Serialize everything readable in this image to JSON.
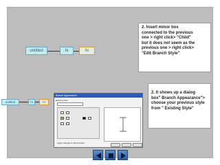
{
  "diagram_top": {
    "root_label": "untitled",
    "child_label": "hi",
    "new_child_label": "hi"
  },
  "note_top": {
    "lines": [
      "2. Insert minor box",
      "connected to the previous",
      "one > right click> \"Child\"",
      "but it does not seem as the",
      "previous one > right click>",
      " \"Edit Branch Style\""
    ]
  },
  "diagram_bottom": {
    "root_label": "untitled",
    "child_label": "hi",
    "new_child_label": "hi"
  },
  "dialog": {
    "title": "Branch Appearance",
    "tabs": "Existing Style",
    "check_label": "Apply changes to all branches"
  },
  "note_bottom": {
    "lines": [
      "2. It shows up a dialog",
      "box\" Branch Appearance\">",
      "choose your previous style",
      "from \" Existing Style\""
    ]
  },
  "navigation": {
    "previous_icon": "arrow-left-icon",
    "home_icon": "square-stop-icon",
    "next_icon": "arrow-right-icon"
  },
  "colors": {
    "frame_bg": "#bdbdbd",
    "node_fill": "#c4ecec",
    "node_border": "#6aa6c7",
    "nav_blue": "#2a5aa6",
    "highlight_orange": "#f0a020"
  }
}
